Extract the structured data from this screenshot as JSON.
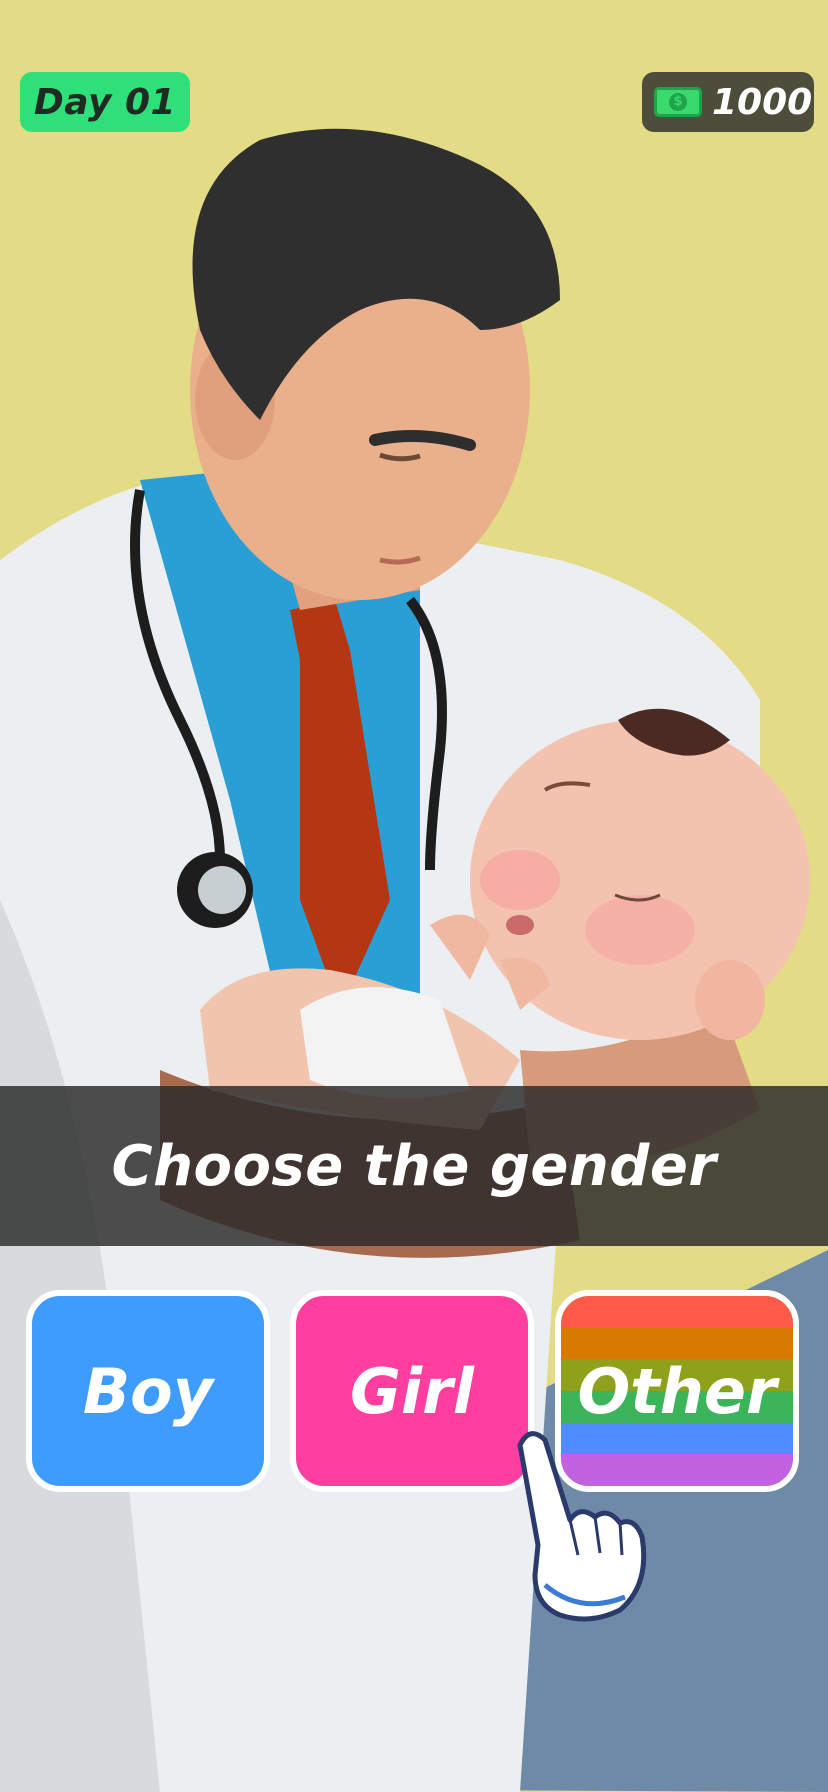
{
  "hud": {
    "day_label": "Day 01",
    "money_icon": "cash-icon",
    "money_value": "1000"
  },
  "prompt": {
    "text": "Choose the gender"
  },
  "choices": [
    {
      "label": "Boy",
      "color": "#3f9cff"
    },
    {
      "label": "Girl",
      "color": "#ff3ea0"
    },
    {
      "label": "Other",
      "stripes": [
        "#ff5a4a",
        "#d97a00",
        "#8ea11a",
        "#3cb55a",
        "#4f8cff",
        "#c262e0"
      ]
    }
  ],
  "tutorial": {
    "icon": "pointing-hand-icon"
  },
  "colors": {
    "background": "#e3db86",
    "day_badge": "#2fe07a",
    "money_badge": "#4d4d3c"
  }
}
